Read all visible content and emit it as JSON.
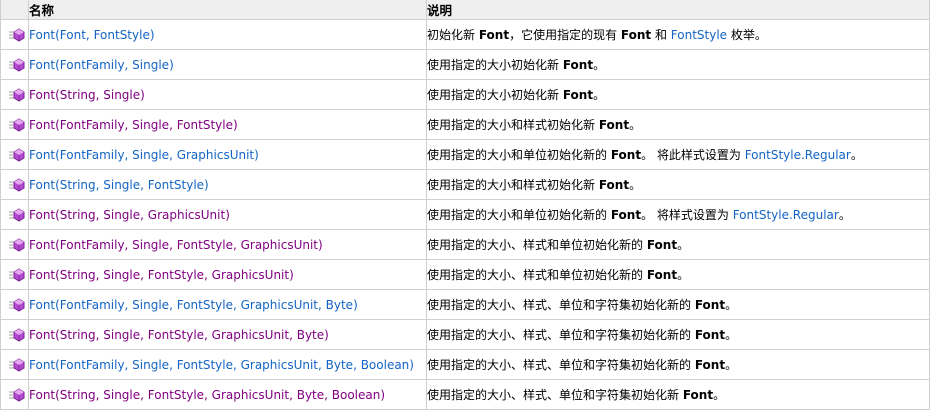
{
  "header": {
    "name_label": "名称",
    "desc_label": "说明"
  },
  "rows": [
    {
      "name": "Font(Font, FontStyle)",
      "link_state": "unvisited",
      "description": [
        {
          "type": "text",
          "value": "初始化新 "
        },
        {
          "type": "bold",
          "value": "Font"
        },
        {
          "type": "text",
          "value": "，它使用指定的现有 "
        },
        {
          "type": "bold",
          "value": "Font"
        },
        {
          "type": "text",
          "value": " 和 "
        },
        {
          "type": "link",
          "value": "FontStyle"
        },
        {
          "type": "text",
          "value": " 枚举。"
        }
      ]
    },
    {
      "name": "Font(FontFamily, Single)",
      "link_state": "unvisited",
      "description": [
        {
          "type": "text",
          "value": "使用指定的大小初始化新 "
        },
        {
          "type": "bold",
          "value": "Font"
        },
        {
          "type": "text",
          "value": "。"
        }
      ]
    },
    {
      "name": "Font(String, Single)",
      "link_state": "visited",
      "description": [
        {
          "type": "text",
          "value": "使用指定的大小初始化新 "
        },
        {
          "type": "bold",
          "value": "Font"
        },
        {
          "type": "text",
          "value": "。"
        }
      ]
    },
    {
      "name": "Font(FontFamily, Single, FontStyle)",
      "link_state": "visited",
      "description": [
        {
          "type": "text",
          "value": "使用指定的大小和样式初始化新 "
        },
        {
          "type": "bold",
          "value": "Font"
        },
        {
          "type": "text",
          "value": "。"
        }
      ]
    },
    {
      "name": "Font(FontFamily, Single, GraphicsUnit)",
      "link_state": "unvisited",
      "description": [
        {
          "type": "text",
          "value": "使用指定的大小和单位初始化新的 "
        },
        {
          "type": "bold",
          "value": "Font"
        },
        {
          "type": "text",
          "value": "。 将此样式设置为 "
        },
        {
          "type": "link",
          "value": "FontStyle.Regular"
        },
        {
          "type": "text",
          "value": "。"
        }
      ]
    },
    {
      "name": "Font(String, Single, FontStyle)",
      "link_state": "unvisited",
      "description": [
        {
          "type": "text",
          "value": "使用指定的大小和样式初始化新 "
        },
        {
          "type": "bold",
          "value": "Font"
        },
        {
          "type": "text",
          "value": "。"
        }
      ]
    },
    {
      "name": "Font(String, Single, GraphicsUnit)",
      "link_state": "visited",
      "description": [
        {
          "type": "text",
          "value": "使用指定的大小和单位初始化新的 "
        },
        {
          "type": "bold",
          "value": "Font"
        },
        {
          "type": "text",
          "value": "。 将样式设置为 "
        },
        {
          "type": "link",
          "value": "FontStyle.Regular"
        },
        {
          "type": "text",
          "value": "。"
        }
      ]
    },
    {
      "name": "Font(FontFamily, Single, FontStyle, GraphicsUnit)",
      "link_state": "visited",
      "description": [
        {
          "type": "text",
          "value": "使用指定的大小、样式和单位初始化新的 "
        },
        {
          "type": "bold",
          "value": "Font"
        },
        {
          "type": "text",
          "value": "。"
        }
      ]
    },
    {
      "name": "Font(String, Single, FontStyle, GraphicsUnit)",
      "link_state": "visited",
      "description": [
        {
          "type": "text",
          "value": "使用指定的大小、样式和单位初始化新的 "
        },
        {
          "type": "bold",
          "value": "Font"
        },
        {
          "type": "text",
          "value": "。"
        }
      ]
    },
    {
      "name": "Font(FontFamily, Single, FontStyle, GraphicsUnit, Byte)",
      "link_state": "unvisited",
      "description": [
        {
          "type": "text",
          "value": "使用指定的大小、样式、单位和字符集初始化新的 "
        },
        {
          "type": "bold",
          "value": "Font"
        },
        {
          "type": "text",
          "value": "。"
        }
      ]
    },
    {
      "name": "Font(String, Single, FontStyle, GraphicsUnit, Byte)",
      "link_state": "visited",
      "description": [
        {
          "type": "text",
          "value": "使用指定的大小、样式、单位和字符集初始化新的 "
        },
        {
          "type": "bold",
          "value": "Font"
        },
        {
          "type": "text",
          "value": "。"
        }
      ]
    },
    {
      "name": "Font(FontFamily, Single, FontStyle, GraphicsUnit, Byte, Boolean)",
      "link_state": "unvisited",
      "description": [
        {
          "type": "text",
          "value": "使用指定的大小、样式、单位和字符集初始化新的 "
        },
        {
          "type": "bold",
          "value": "Font"
        },
        {
          "type": "text",
          "value": "。"
        }
      ]
    },
    {
      "name": "Font(String, Single, FontStyle, GraphicsUnit, Byte, Boolean)",
      "link_state": "visited",
      "description": [
        {
          "type": "text",
          "value": "使用指定的大小、样式、单位和字符集初始化新 "
        },
        {
          "type": "bold",
          "value": "Font"
        },
        {
          "type": "text",
          "value": "。"
        }
      ]
    }
  ],
  "icon": {
    "name": "public-method-icon"
  },
  "colors": {
    "link_unvisited": "#1364c4",
    "link_visited": "#800080",
    "header_bg": "#efefef",
    "border": "#cfcfcf"
  }
}
